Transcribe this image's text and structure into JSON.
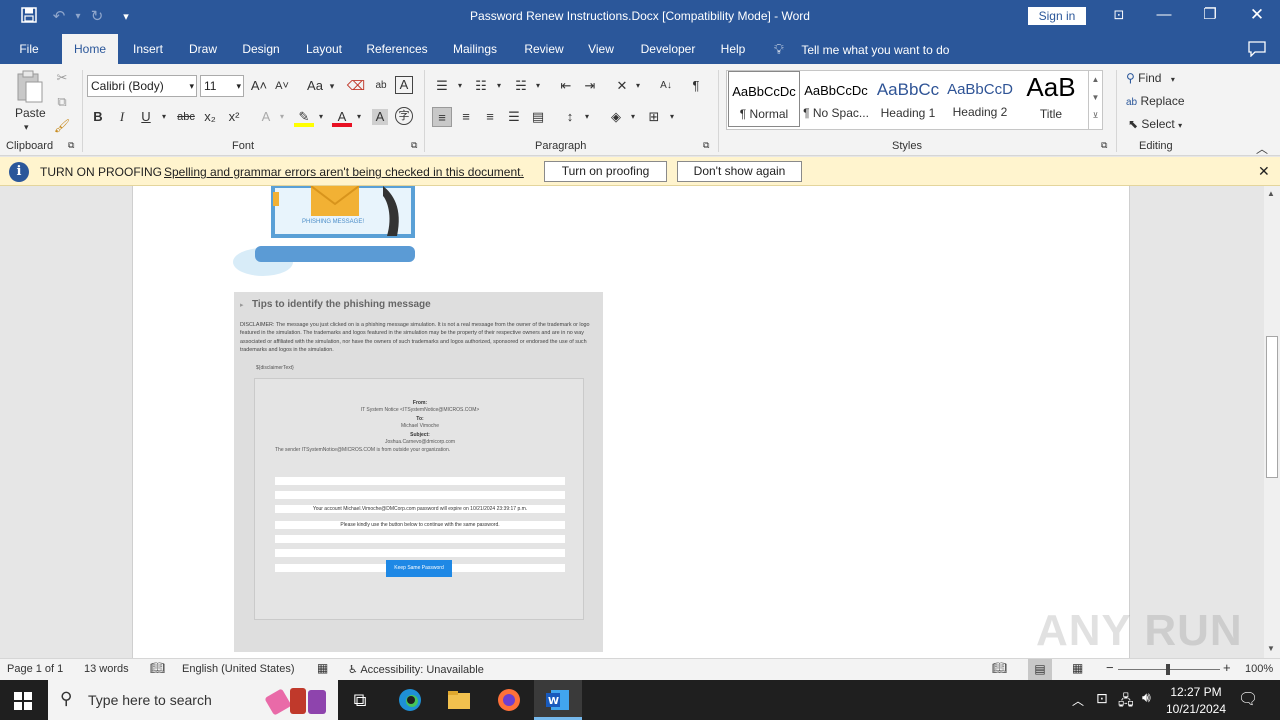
{
  "titlebar": {
    "title": "Password Renew Instructions.Docx [Compatibility Mode]  -  Word",
    "sign_in": "Sign in",
    "save_icon": "save-icon",
    "undo_icon": "undo-icon",
    "redo_icon": "redo-icon",
    "customize_icon": "chevron-down-icon",
    "ribbon_display_icon": "ribbon-display-icon",
    "minimize_icon": "minimize-icon",
    "maximize_icon": "restore-icon",
    "close_icon": "close-icon"
  },
  "tabs": [
    {
      "label": "File"
    },
    {
      "label": "Home"
    },
    {
      "label": "Insert"
    },
    {
      "label": "Draw"
    },
    {
      "label": "Design"
    },
    {
      "label": "Layout"
    },
    {
      "label": "References"
    },
    {
      "label": "Mailings"
    },
    {
      "label": "Review"
    },
    {
      "label": "View"
    },
    {
      "label": "Developer"
    },
    {
      "label": "Help"
    }
  ],
  "tell_me": "Tell me what you want to do",
  "ribbon": {
    "clipboard": {
      "paste": "Paste",
      "label": "Clipboard"
    },
    "font": {
      "name": "Calibri (Body)",
      "size": "11",
      "label": "Font",
      "case": "Aa",
      "bold": "B",
      "italic": "I",
      "underline": "U",
      "strike": "abc",
      "subscript": "x₂",
      "superscript": "x²",
      "grow": "A˄",
      "shrink": "A˅"
    },
    "paragraph": {
      "label": "Paragraph",
      "pilcrow": "¶"
    },
    "styles": {
      "label": "Styles",
      "items": [
        {
          "sample": "AaBbCcDc",
          "name": "¶ Normal"
        },
        {
          "sample": "AaBbCcDc",
          "name": "¶ No Spac..."
        },
        {
          "sample": "AaBbCc",
          "name": "Heading 1"
        },
        {
          "sample": "AaBbCcD",
          "name": "Heading 2"
        },
        {
          "sample": "AaB",
          "name": "Title"
        }
      ]
    },
    "editing": {
      "label": "Editing",
      "find": "Find",
      "replace": "Replace",
      "select": "Select"
    }
  },
  "proofing": {
    "title": "TURN ON PROOFING",
    "message": "Spelling and grammar errors aren't being checked in this document.",
    "turn_on": "Turn on proofing",
    "dont_show": "Don't show again"
  },
  "document": {
    "image_caption": "PHISHING MESSAGE!",
    "tips_title": "Tips to identify the phishing message",
    "disclaimer": "DISCLAIMER: The message you just clicked on is a phishing message simulation. It is not a real message from the owner of the trademark or logo featured in the simulation. The trademarks and logos featured in the simulation may be the property of their respective owners and are in no way associated or affiliated with the simulation, nor have the owners of such trademarks and logos authorized, sponsored or endorsed the use of such trademarks and logos in the simulation.",
    "disclaimer_var": "${disclaimerText}",
    "email": {
      "from_label": "From:",
      "from_value": "IT System Notice <ITSystemNotice@MICROS.COM>",
      "to_label": "To:",
      "to_value": "Michael Vimoche",
      "subject_label": "Subject:",
      "subject_value": "Joshua.Carnevo@dmicorp.com",
      "external_note": "The sender ITSystemNotice@MICROS.COM is from outside your organization.",
      "body_line1": "Your account Michael.Vimoche@DMCorp.com password will expire on 10/21/2024 23:39:17 p.m.",
      "body_line2": "Please kindly use the button below to continue with the same password.",
      "button": "Keep Same Password"
    }
  },
  "statusbar": {
    "page": "Page 1 of 1",
    "words": "13 words",
    "language": "English (United States)",
    "accessibility": "Accessibility: Unavailable",
    "zoom": "100%",
    "zoom_level": 0.5
  },
  "taskbar": {
    "search_placeholder": "Type here to search",
    "time": "12:27 PM",
    "date": "10/21/2024"
  },
  "watermark": "ANY RUN",
  "colors": {
    "accent": "#2b579a",
    "proof_bar": "#fff4ce",
    "button_blue": "#1e88e5"
  }
}
